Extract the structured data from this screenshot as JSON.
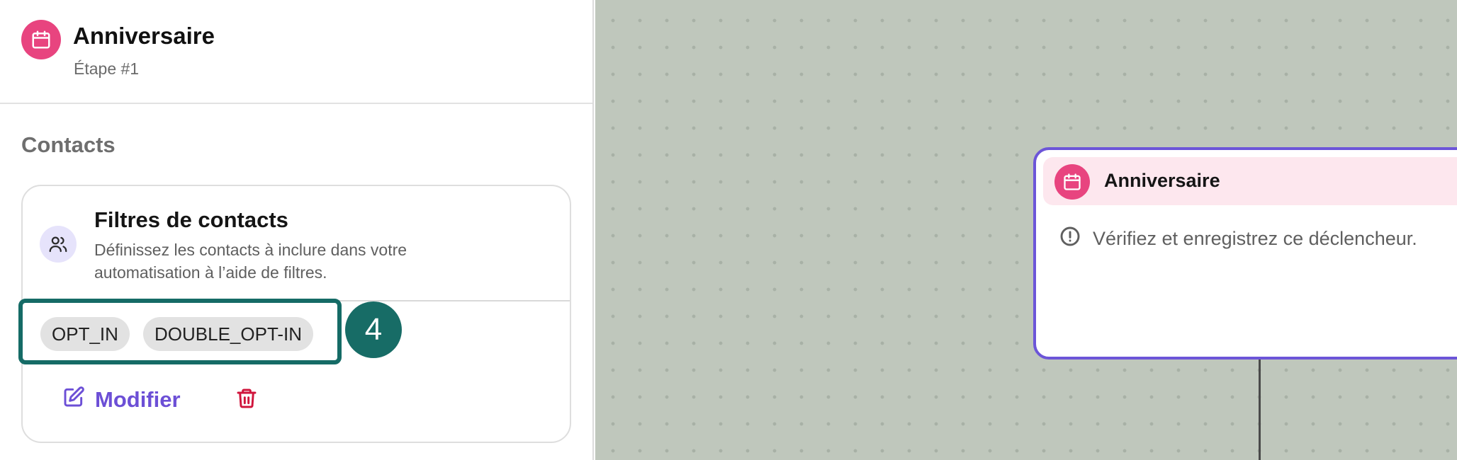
{
  "panel": {
    "header": {
      "title": "Anniversaire",
      "subtitle": "Étape #1",
      "icon": "calendar-icon",
      "icon_color": "#e8447f"
    },
    "section_title": "Contacts",
    "filter_card": {
      "title": "Filtres de contacts",
      "description": "Définissez les contacts à inclure dans votre automatisation à l’aide de filtres.",
      "icon": "users-icon",
      "tags": [
        "OPT_IN",
        "DOUBLE_OPT-IN"
      ],
      "edit_label": "Modifier",
      "accent_color": "#6c4fd6",
      "delete_color": "#d0153c"
    },
    "callout_badge": "4"
  },
  "canvas": {
    "node": {
      "title": "Anniversaire",
      "warning": "Vérifiez et enregistrez ce déclencheur.",
      "border_color": "#6c55d8"
    }
  }
}
